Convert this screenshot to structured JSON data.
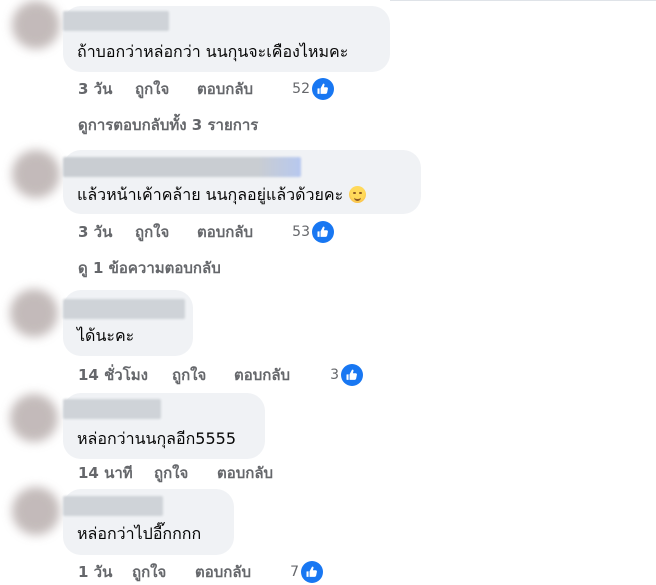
{
  "comments": [
    {
      "text": "ถ้าบอกว่าหล่อกว่า นนกุนจะเคืองไหมคะ",
      "time": "3 วัน",
      "like_label": "ถูกใจ",
      "reply_label": "ตอบกลับ",
      "reaction_count": "52"
    },
    {
      "text": "แล้วหน้าเค้าคล้าย นนกุลอยู่แล้วด้วยคะ",
      "time": "3 วัน",
      "like_label": "ถูกใจ",
      "reply_label": "ตอบกลับ",
      "reaction_count": "53",
      "emoji": "smiling-face"
    },
    {
      "text": "ได้นะคะ",
      "time": "14 ชั่วโมง",
      "like_label": "ถูกใจ",
      "reply_label": "ตอบกลับ",
      "reaction_count": "3"
    },
    {
      "text": "หล่อกว่านนกุลอีก5555",
      "time": "14 นาที",
      "like_label": "ถูกใจ",
      "reply_label": "ตอบกลับ"
    },
    {
      "text": "หล่อกว่าไปอี๊กกกก",
      "time": "1 วัน",
      "like_label": "ถูกใจ",
      "reply_label": "ตอบกลับ",
      "reaction_count": "7"
    }
  ],
  "reply_links": {
    "first": "ดูการตอบกลับทั้ง 3 รายการ",
    "second": "ดู 1 ข้อความตอบกลับ"
  },
  "icons": {
    "reaction": "like-icon",
    "emoji": "smiling-face-emoji"
  },
  "colors": {
    "like_blue": "#1877f2",
    "bubble": "#f0f2f5",
    "secondary_text": "#65676b"
  }
}
